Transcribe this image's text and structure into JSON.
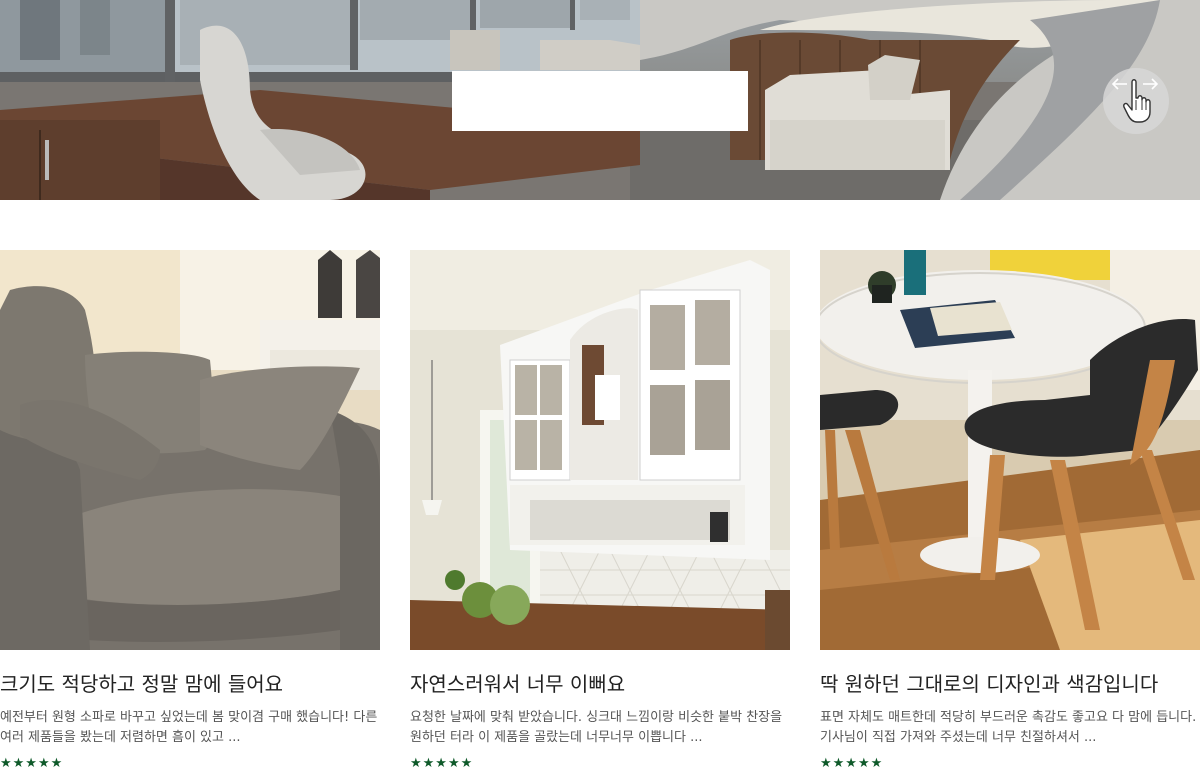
{
  "hero": {
    "title": "",
    "swipe_hint_icon": "swipe-left-right-hand-icon"
  },
  "reviews": [
    {
      "title": "크기도 적당하고 정말 맘에 들어요",
      "desc": "예전부터 원형 소파로 바꾸고 싶었는데 봄 맞이겸 구매 했습니다! 다른 여러 제품들을 봤는데 저렴하면 흠이 있고 ...",
      "stars": "★★★★★",
      "rating": 5,
      "image": "gray-armchair-photo"
    },
    {
      "title": "자연스러워서 너무 이뻐요",
      "desc": "요청한 날짜에 맞춰 받았습니다. 싱크대 느낌이랑 비슷한 붙박 찬장을 원하던 터라 이 제품을 골랐는데 너무너무 이쁩니다 ...",
      "stars": "★★★★★",
      "rating": 5,
      "image": "white-kitchen-cabinet-photo"
    },
    {
      "title": "딱 원하던 그대로의 디자인과 색감입니다",
      "desc": "표면 자체도 매트한데 적당히 부드러운 촉감도 좋고요 다 맘에 듭니다. 기사님이 직접 가져와 주셨는데 너무 친절하셔서 ...",
      "stars": "★★★★★",
      "rating": 5,
      "image": "round-table-chairs-photo"
    }
  ],
  "colors": {
    "star": "#0f5a2a",
    "title": "#222222",
    "desc": "#555555"
  }
}
